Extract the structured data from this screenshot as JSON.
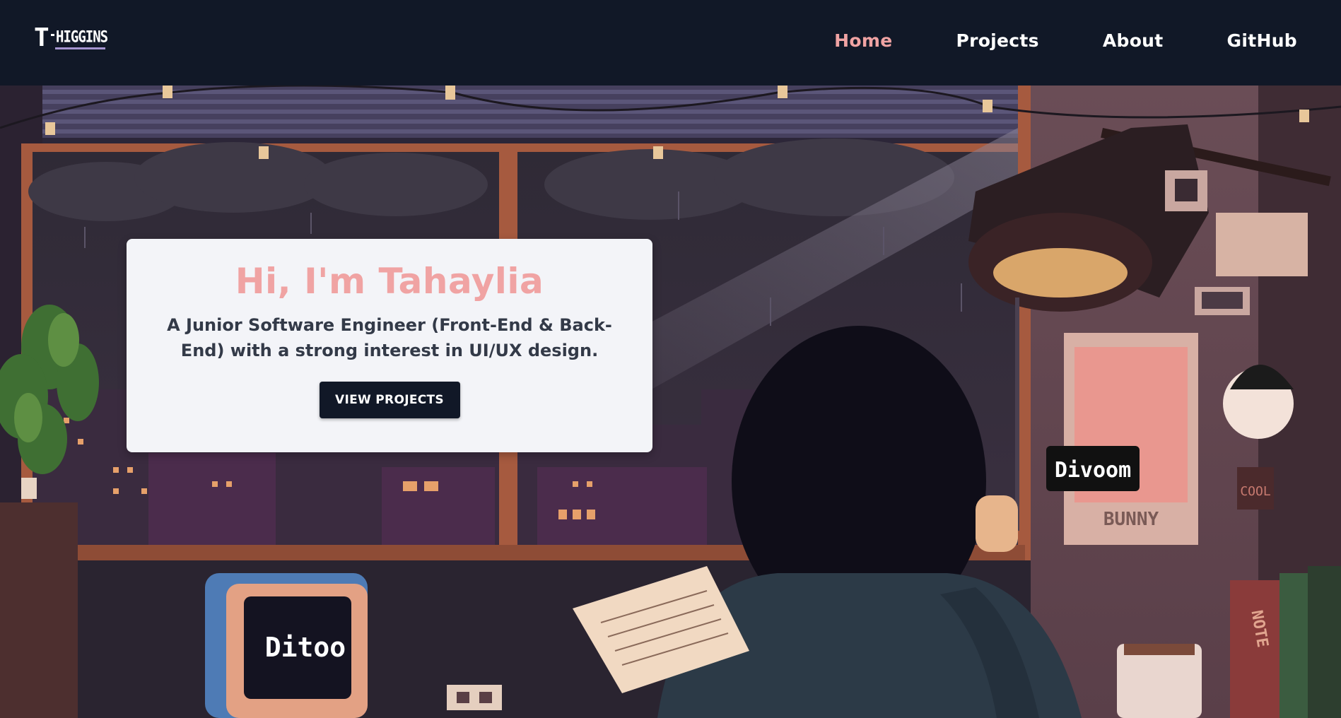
{
  "nav": {
    "logo_letter": "T",
    "logo_name": "HIGGINS",
    "links": [
      {
        "label": "Home",
        "active": true
      },
      {
        "label": "Projects",
        "active": false
      },
      {
        "label": "About",
        "active": false
      },
      {
        "label": "GitHub",
        "active": false
      }
    ],
    "active_color": "#f0a3a3",
    "background": "#111827"
  },
  "hero": {
    "title": "Hi, I'm Tahaylia",
    "subtitle": "A Junior Software Engineer (Front-End & Back-End) with a strong interest in UI/UX design.",
    "button_label": "VIEW PROJECTS",
    "title_color": "#f0a3a3",
    "button_color": "#111827"
  },
  "scene": {
    "description_icon": "pixel-art-room-illustration",
    "ditoo_label": "Ditoo",
    "divoom_label": "Divoom",
    "bunny_label": "BUNNY",
    "note_label": "NOTE",
    "glasses_label": "COOL"
  }
}
